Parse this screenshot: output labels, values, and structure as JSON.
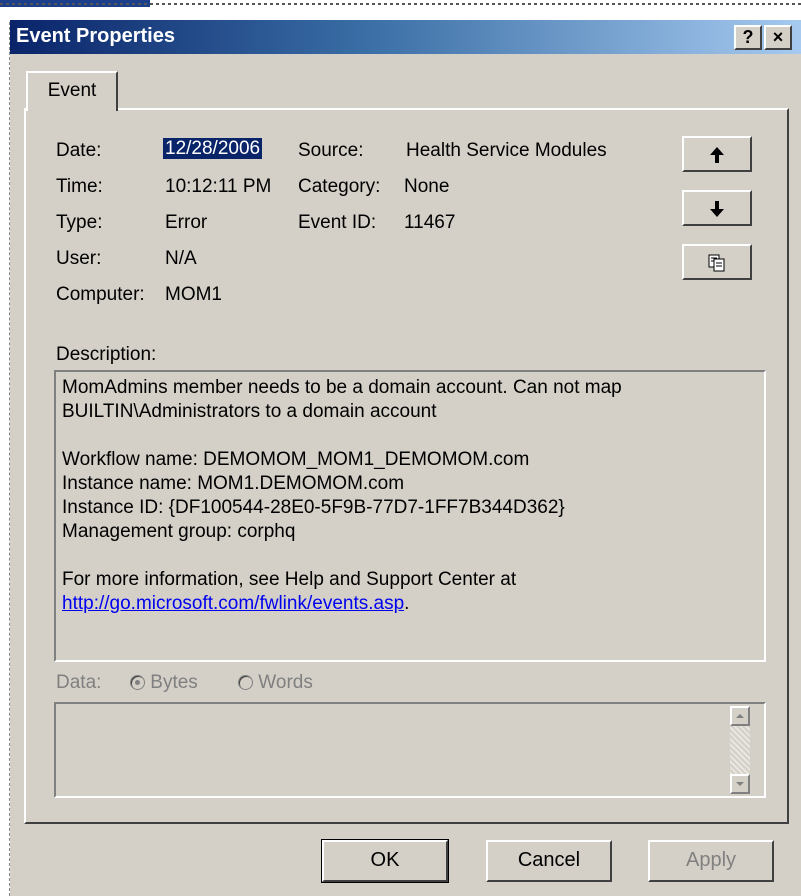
{
  "window": {
    "title": "Event Properties",
    "help_label": "?",
    "close_label": "×"
  },
  "tab": {
    "label": "Event"
  },
  "fields": {
    "date_label": "Date:",
    "date_value": "12/28/2006",
    "time_label": "Time:",
    "time_value": "10:12:11 PM",
    "type_label": "Type:",
    "type_value": "Error",
    "user_label": "User:",
    "user_value": "N/A",
    "computer_label": "Computer:",
    "computer_value": "MOM1",
    "source_label": "Source:",
    "source_value": "Health Service Modules",
    "category_label": "Category:",
    "category_value": "None",
    "eventid_label": "Event ID:",
    "eventid_value": "11467"
  },
  "side_buttons": {
    "up_icon": "arrow-up-icon",
    "down_icon": "arrow-down-icon",
    "copy_icon": "copy-icon"
  },
  "description": {
    "label": "Description:",
    "line1": "MomAdmins member needs to be a domain account. Can not map",
    "line2": "BUILTIN\\Administrators to a domain account",
    "line3": "Workflow name: DEMOMOM_MOM1_DEMOMOM.com",
    "line4": "Instance name: MOM1.DEMOMOM.com",
    "line5": "Instance ID: {DF100544-28E0-5F9B-77D7-1FF7B344D362}",
    "line6": "Management group: corphq",
    "line7": "For more information, see Help and Support Center at",
    "link": "http://go.microsoft.com/fwlink/events.asp",
    "link_suffix": "."
  },
  "data": {
    "label": "Data:",
    "bytes_label": "Bytes",
    "words_label": "Words",
    "selected": "Bytes"
  },
  "buttons": {
    "ok": "OK",
    "cancel": "Cancel",
    "apply": "Apply"
  }
}
